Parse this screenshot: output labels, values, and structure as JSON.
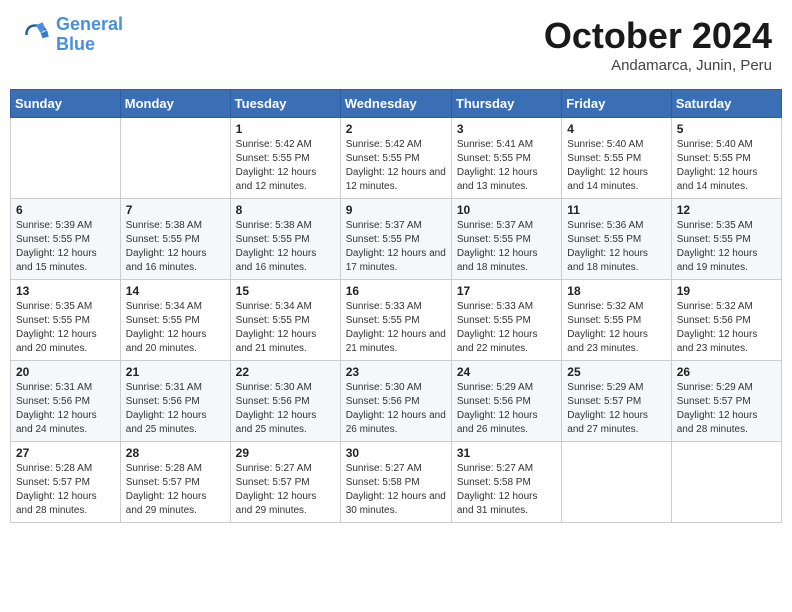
{
  "header": {
    "logo_line1": "General",
    "logo_line2": "Blue",
    "month": "October 2024",
    "location": "Andamarca, Junin, Peru"
  },
  "days_of_week": [
    "Sunday",
    "Monday",
    "Tuesday",
    "Wednesday",
    "Thursday",
    "Friday",
    "Saturday"
  ],
  "weeks": [
    [
      {
        "day": "",
        "info": ""
      },
      {
        "day": "",
        "info": ""
      },
      {
        "day": "1",
        "info": "Sunrise: 5:42 AM\nSunset: 5:55 PM\nDaylight: 12 hours and 12 minutes."
      },
      {
        "day": "2",
        "info": "Sunrise: 5:42 AM\nSunset: 5:55 PM\nDaylight: 12 hours and 12 minutes."
      },
      {
        "day": "3",
        "info": "Sunrise: 5:41 AM\nSunset: 5:55 PM\nDaylight: 12 hours and 13 minutes."
      },
      {
        "day": "4",
        "info": "Sunrise: 5:40 AM\nSunset: 5:55 PM\nDaylight: 12 hours and 14 minutes."
      },
      {
        "day": "5",
        "info": "Sunrise: 5:40 AM\nSunset: 5:55 PM\nDaylight: 12 hours and 14 minutes."
      }
    ],
    [
      {
        "day": "6",
        "info": "Sunrise: 5:39 AM\nSunset: 5:55 PM\nDaylight: 12 hours and 15 minutes."
      },
      {
        "day": "7",
        "info": "Sunrise: 5:38 AM\nSunset: 5:55 PM\nDaylight: 12 hours and 16 minutes."
      },
      {
        "day": "8",
        "info": "Sunrise: 5:38 AM\nSunset: 5:55 PM\nDaylight: 12 hours and 16 minutes."
      },
      {
        "day": "9",
        "info": "Sunrise: 5:37 AM\nSunset: 5:55 PM\nDaylight: 12 hours and 17 minutes."
      },
      {
        "day": "10",
        "info": "Sunrise: 5:37 AM\nSunset: 5:55 PM\nDaylight: 12 hours and 18 minutes."
      },
      {
        "day": "11",
        "info": "Sunrise: 5:36 AM\nSunset: 5:55 PM\nDaylight: 12 hours and 18 minutes."
      },
      {
        "day": "12",
        "info": "Sunrise: 5:35 AM\nSunset: 5:55 PM\nDaylight: 12 hours and 19 minutes."
      }
    ],
    [
      {
        "day": "13",
        "info": "Sunrise: 5:35 AM\nSunset: 5:55 PM\nDaylight: 12 hours and 20 minutes."
      },
      {
        "day": "14",
        "info": "Sunrise: 5:34 AM\nSunset: 5:55 PM\nDaylight: 12 hours and 20 minutes."
      },
      {
        "day": "15",
        "info": "Sunrise: 5:34 AM\nSunset: 5:55 PM\nDaylight: 12 hours and 21 minutes."
      },
      {
        "day": "16",
        "info": "Sunrise: 5:33 AM\nSunset: 5:55 PM\nDaylight: 12 hours and 21 minutes."
      },
      {
        "day": "17",
        "info": "Sunrise: 5:33 AM\nSunset: 5:55 PM\nDaylight: 12 hours and 22 minutes."
      },
      {
        "day": "18",
        "info": "Sunrise: 5:32 AM\nSunset: 5:55 PM\nDaylight: 12 hours and 23 minutes."
      },
      {
        "day": "19",
        "info": "Sunrise: 5:32 AM\nSunset: 5:56 PM\nDaylight: 12 hours and 23 minutes."
      }
    ],
    [
      {
        "day": "20",
        "info": "Sunrise: 5:31 AM\nSunset: 5:56 PM\nDaylight: 12 hours and 24 minutes."
      },
      {
        "day": "21",
        "info": "Sunrise: 5:31 AM\nSunset: 5:56 PM\nDaylight: 12 hours and 25 minutes."
      },
      {
        "day": "22",
        "info": "Sunrise: 5:30 AM\nSunset: 5:56 PM\nDaylight: 12 hours and 25 minutes."
      },
      {
        "day": "23",
        "info": "Sunrise: 5:30 AM\nSunset: 5:56 PM\nDaylight: 12 hours and 26 minutes."
      },
      {
        "day": "24",
        "info": "Sunrise: 5:29 AM\nSunset: 5:56 PM\nDaylight: 12 hours and 26 minutes."
      },
      {
        "day": "25",
        "info": "Sunrise: 5:29 AM\nSunset: 5:57 PM\nDaylight: 12 hours and 27 minutes."
      },
      {
        "day": "26",
        "info": "Sunrise: 5:29 AM\nSunset: 5:57 PM\nDaylight: 12 hours and 28 minutes."
      }
    ],
    [
      {
        "day": "27",
        "info": "Sunrise: 5:28 AM\nSunset: 5:57 PM\nDaylight: 12 hours and 28 minutes."
      },
      {
        "day": "28",
        "info": "Sunrise: 5:28 AM\nSunset: 5:57 PM\nDaylight: 12 hours and 29 minutes."
      },
      {
        "day": "29",
        "info": "Sunrise: 5:27 AM\nSunset: 5:57 PM\nDaylight: 12 hours and 29 minutes."
      },
      {
        "day": "30",
        "info": "Sunrise: 5:27 AM\nSunset: 5:58 PM\nDaylight: 12 hours and 30 minutes."
      },
      {
        "day": "31",
        "info": "Sunrise: 5:27 AM\nSunset: 5:58 PM\nDaylight: 12 hours and 31 minutes."
      },
      {
        "day": "",
        "info": ""
      },
      {
        "day": "",
        "info": ""
      }
    ]
  ]
}
